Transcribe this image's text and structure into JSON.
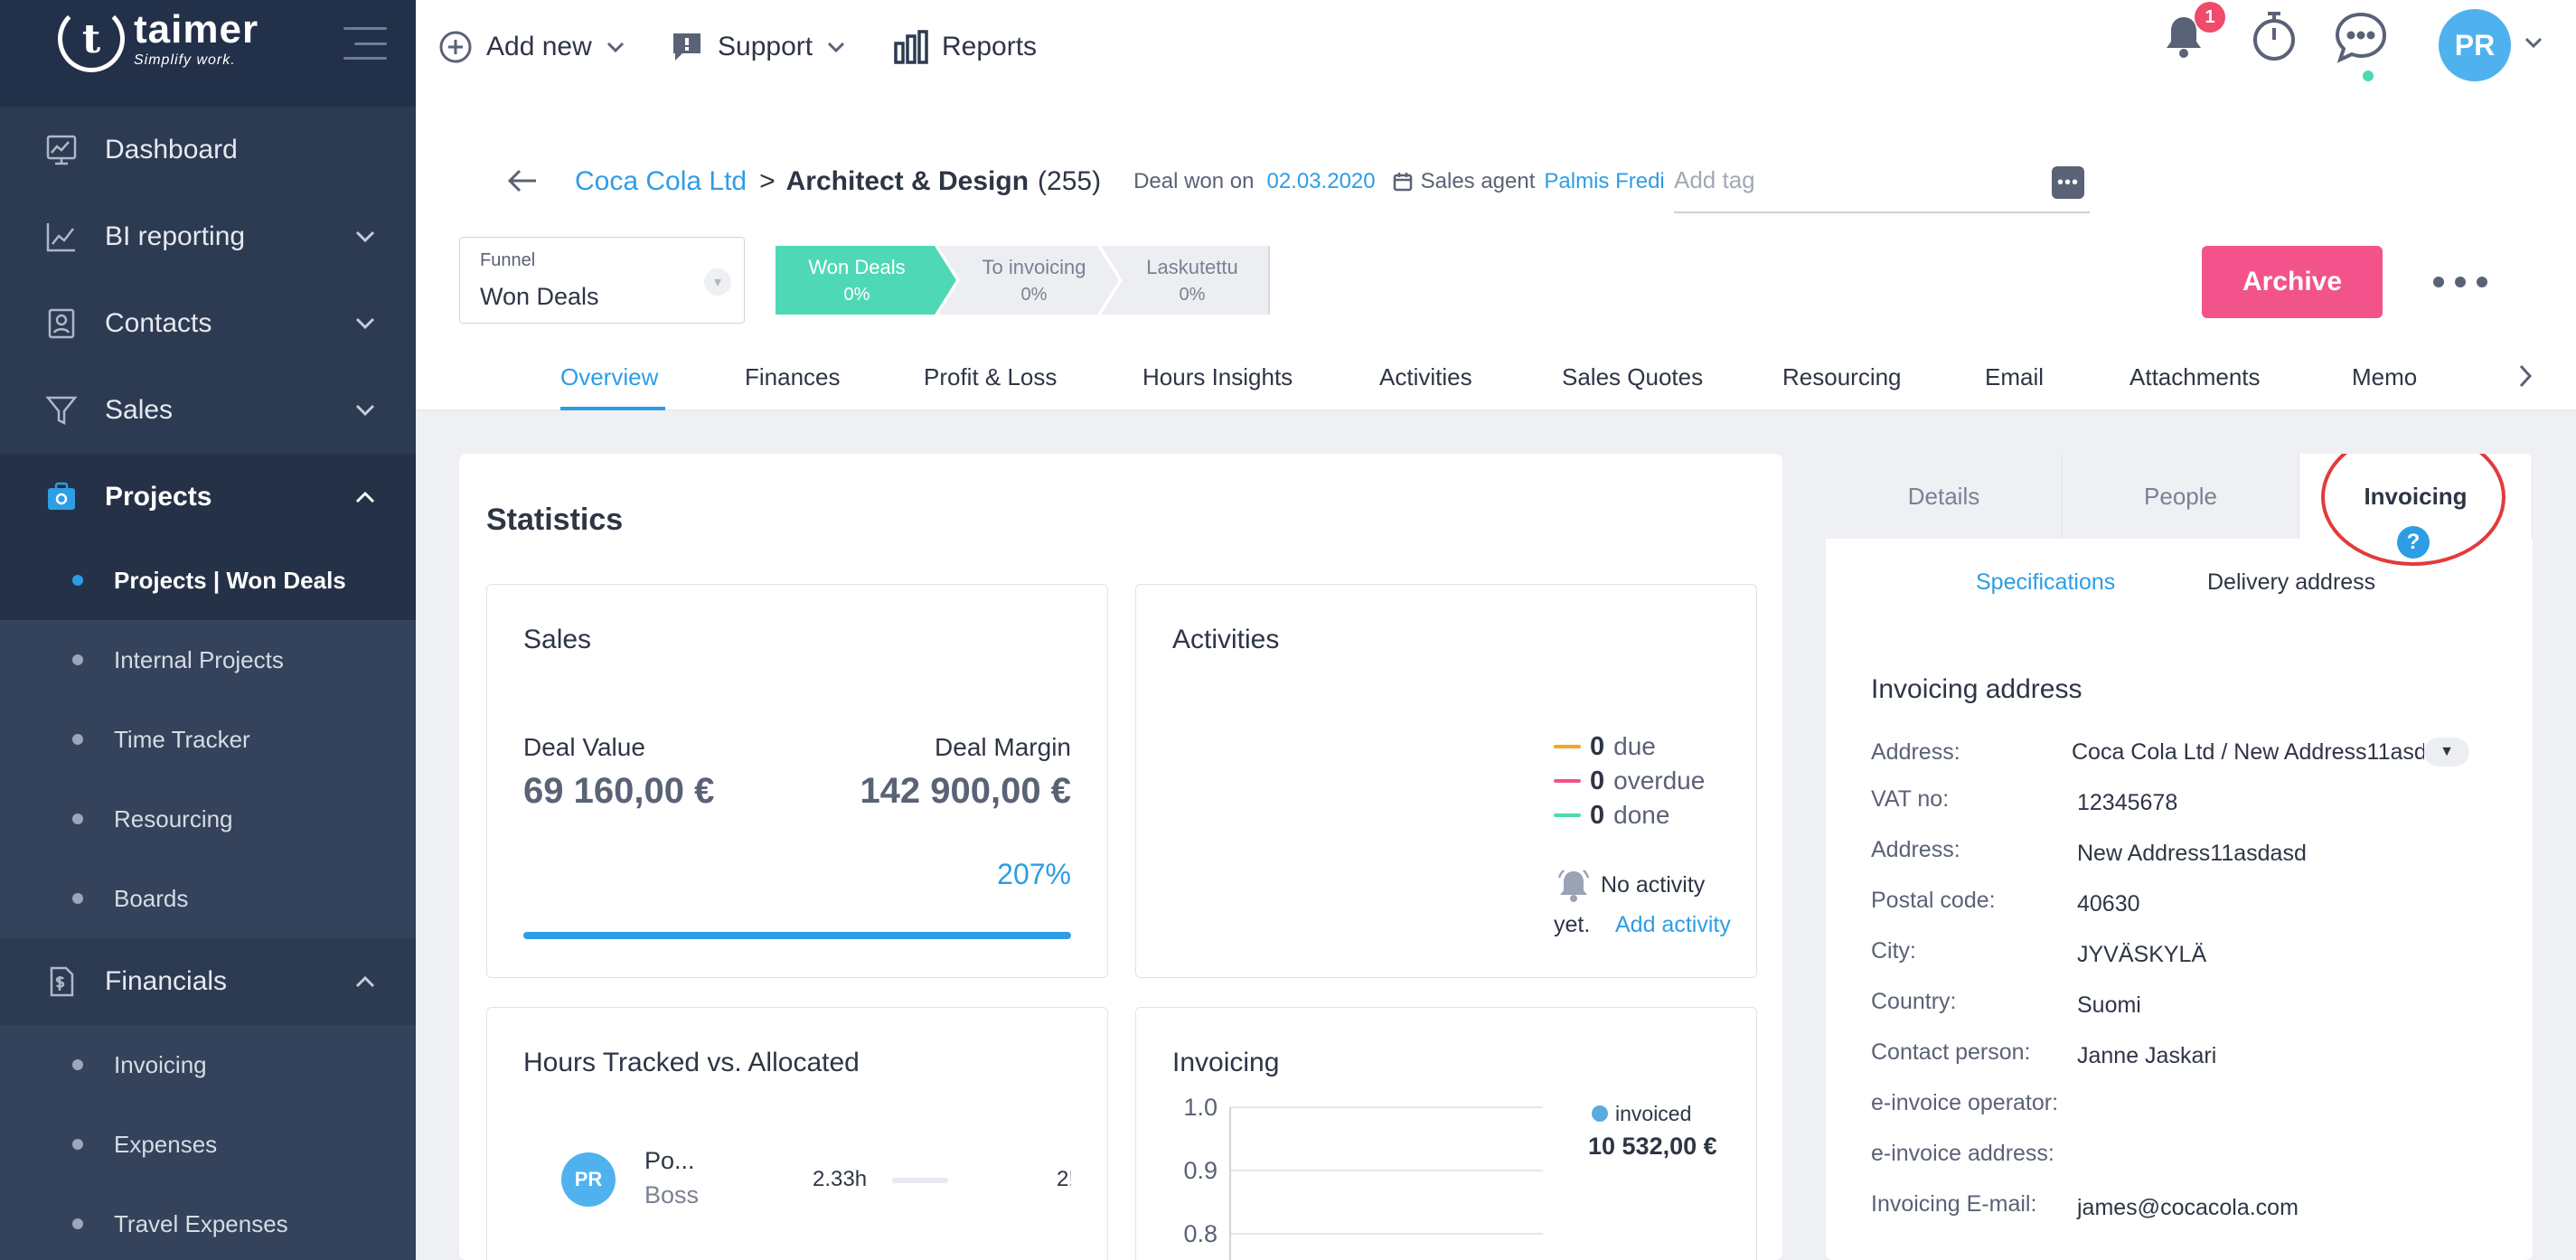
{
  "app": {
    "brand": "taimer",
    "tagline": "Simplify work."
  },
  "sidebar": {
    "items": [
      {
        "label": "Dashboard",
        "icon": "dashboard-icon"
      },
      {
        "label": "BI reporting",
        "icon": "chart-line-icon"
      },
      {
        "label": "Contacts",
        "icon": "contacts-icon"
      },
      {
        "label": "Sales",
        "icon": "funnel-icon"
      },
      {
        "label": "Projects",
        "icon": "projects-icon"
      },
      {
        "label": "Financials",
        "icon": "financials-icon"
      }
    ],
    "projects_sub": [
      "Projects | Won Deals",
      "Internal Projects",
      "Time Tracker",
      "Resourcing",
      "Boards"
    ],
    "financials_sub": [
      "Invoicing",
      "Expenses",
      "Travel Expenses"
    ]
  },
  "topbar": {
    "add_new": "Add new",
    "support": "Support",
    "reports": "Reports",
    "notification_count": "1",
    "avatar_initials": "PR"
  },
  "header": {
    "company": "Coca Cola Ltd",
    "separator": ">",
    "project": "Architect & Design",
    "project_id": "(255)",
    "deal_won_label": "Deal won on",
    "deal_won_date": "02.03.2020",
    "sales_agent_label": "Sales agent",
    "sales_agent": "Palmis Fredi",
    "tag_placeholder": "Add tag",
    "funnel_label": "Funnel",
    "funnel_value": "Won Deals",
    "stages": [
      {
        "name": "Won Deals",
        "pct": "0%"
      },
      {
        "name": "To invoicing",
        "pct": "0%"
      },
      {
        "name": "Laskutettu",
        "pct": "0%"
      }
    ],
    "archive_label": "Archive",
    "tabs": [
      "Overview",
      "Finances",
      "Profit & Loss",
      "Hours Insights",
      "Activities",
      "Sales Quotes",
      "Resourcing",
      "Email",
      "Attachments",
      "Memo"
    ]
  },
  "statistics": {
    "title": "Statistics",
    "sales": {
      "title": "Sales",
      "deal_value_label": "Deal Value",
      "deal_value": "69 160,00 €",
      "deal_margin_label": "Deal Margin",
      "deal_margin": "142 900,00 €",
      "margin_pct": "207%",
      "progress": 1.0
    },
    "activities": {
      "title": "Activities",
      "due_count": "0",
      "due_label": "due",
      "overdue_count": "0",
      "overdue_label": "overdue",
      "done_count": "0",
      "done_label": "done",
      "no_activity": "No activity",
      "yet": "yet.",
      "add_activity": "Add activity",
      "colors": {
        "due": "#f5a623",
        "overdue": "#f2538a",
        "done": "#4fd8b5"
      }
    },
    "hours": {
      "title": "Hours Tracked vs. Allocated",
      "rows": [
        {
          "initials": "PR",
          "name": "Po...",
          "role": "Boss",
          "hours": "2.33h",
          "allocated": "2!"
        }
      ]
    },
    "invoicing": {
      "title": "Invoicing",
      "legend": "invoiced",
      "amount": "10 532,00 €"
    }
  },
  "chart_data": {
    "type": "line",
    "title": "Invoicing",
    "series": [
      {
        "name": "invoiced",
        "values": []
      }
    ],
    "yticks": [
      "1.0",
      "0.9",
      "0.8"
    ],
    "ylim": [
      0.8,
      1.0
    ],
    "grid": true,
    "legend": "top-right"
  },
  "details": {
    "tabs": [
      "Details",
      "People",
      "Invoicing"
    ],
    "subtabs": [
      "Specifications",
      "Delivery address"
    ],
    "section_title": "Invoicing address",
    "address_select": "Coca Cola Ltd / New Address11asd",
    "rows": [
      {
        "label": "Address:",
        "value": ""
      },
      {
        "label": "VAT no:",
        "value": "12345678"
      },
      {
        "label": "Address:",
        "value": "New Address11asdasd"
      },
      {
        "label": "Postal code:",
        "value": "40630"
      },
      {
        "label": "City:",
        "value": "JYVÄSKYLÄ"
      },
      {
        "label": "Country:",
        "value": "Suomi"
      },
      {
        "label": "Contact person:",
        "value": "Janne Jaskari"
      },
      {
        "label": "e-invoice operator:",
        "value": ""
      },
      {
        "label": "e-invoice address:",
        "value": ""
      },
      {
        "label": "Invoicing E-mail:",
        "value": "james@cocacola.com"
      }
    ]
  }
}
